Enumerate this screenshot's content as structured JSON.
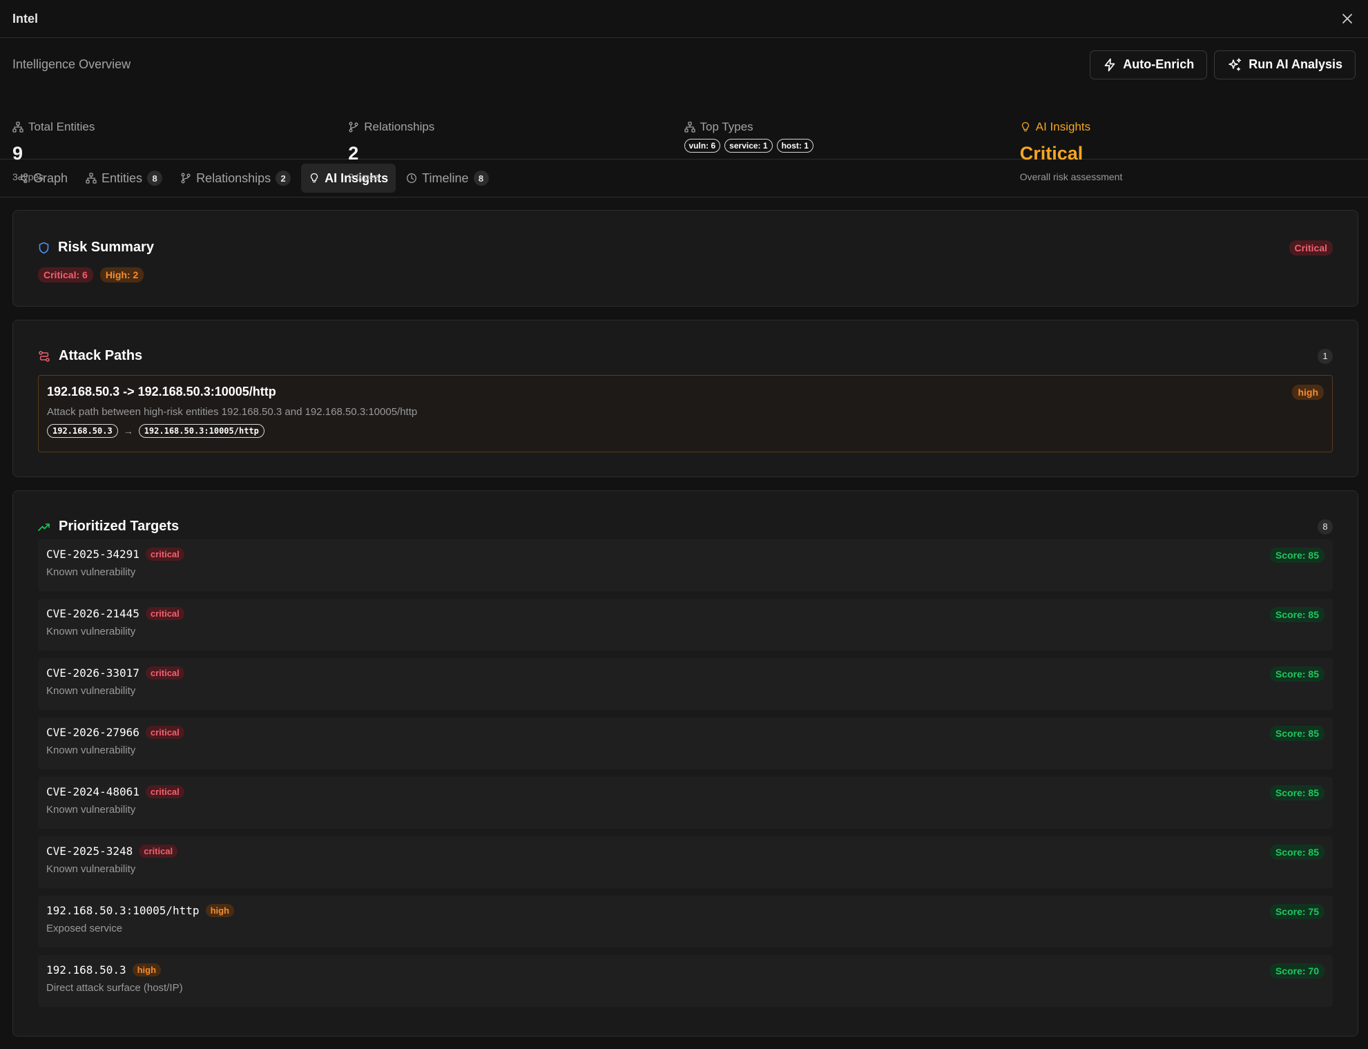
{
  "window": {
    "title": "Intel"
  },
  "overview": {
    "title": "Intelligence Overview",
    "actions": {
      "auto_enrich": "Auto-Enrich",
      "run_ai": "Run AI Analysis"
    },
    "stats": {
      "total": {
        "label": "Total Entities",
        "value": "9",
        "sub": "3 types"
      },
      "relationships": {
        "label": "Relationships",
        "value": "2",
        "sub": "2 types"
      },
      "top_types": {
        "label": "Top Types",
        "chips": [
          "vuln: 6",
          "service: 1",
          "host: 1"
        ]
      },
      "ai": {
        "label": "AI Insights",
        "value": "Critical",
        "sub": "Overall risk assessment"
      }
    }
  },
  "tabs": [
    {
      "label": "Graph",
      "count": ""
    },
    {
      "label": "Entities",
      "count": "8"
    },
    {
      "label": "Relationships",
      "count": "2"
    },
    {
      "label": "AI Insights",
      "count": ""
    },
    {
      "label": "Timeline",
      "count": "8"
    }
  ],
  "risk_summary": {
    "title": "Risk Summary",
    "level": "Critical",
    "critical": "Critical: 6",
    "high": "High: 2"
  },
  "attack_paths": {
    "title": "Attack Paths",
    "count": "1",
    "items": [
      {
        "title": "192.168.50.3 -> 192.168.50.3:10005/http",
        "severity": "high",
        "description": "Attack path between high-risk entities 192.168.50.3 and 192.168.50.3:10005/http",
        "from": "192.168.50.3",
        "arrow": "→",
        "to": "192.168.50.3:10005/http"
      }
    ]
  },
  "targets": {
    "title": "Prioritized Targets",
    "count": "8",
    "items": [
      {
        "name": "CVE-2025-34291",
        "severity": "critical",
        "desc": "Known vulnerability",
        "score": "Score: 85"
      },
      {
        "name": "CVE-2026-21445",
        "severity": "critical",
        "desc": "Known vulnerability",
        "score": "Score: 85"
      },
      {
        "name": "CVE-2026-33017",
        "severity": "critical",
        "desc": "Known vulnerability",
        "score": "Score: 85"
      },
      {
        "name": "CVE-2026-27966",
        "severity": "critical",
        "desc": "Known vulnerability",
        "score": "Score: 85"
      },
      {
        "name": "CVE-2024-48061",
        "severity": "critical",
        "desc": "Known vulnerability",
        "score": "Score: 85"
      },
      {
        "name": "CVE-2025-3248",
        "severity": "critical",
        "desc": "Known vulnerability",
        "score": "Score: 85"
      },
      {
        "name": "192.168.50.3:10005/http",
        "severity": "high",
        "desc": "Exposed service",
        "score": "Score: 75"
      },
      {
        "name": "192.168.50.3",
        "severity": "high",
        "desc": "Direct attack surface (host/IP)",
        "score": "Score: 70"
      }
    ]
  },
  "colors": {
    "background": "#121212",
    "card": "#1a1a1a",
    "accent_amber": "#f5a623",
    "critical": "#f0616d",
    "high": "#f48c2f",
    "score": "#22c55e",
    "shield": "#4f8ef7"
  },
  "icons": {
    "close": "close-icon",
    "auto_enrich": "lightning-icon",
    "run_ai": "sparkles-icon",
    "entities": "network-icon",
    "relationships": "git-branch-icon",
    "ai_insights": "lightbulb-icon",
    "graph": "share-nodes-icon",
    "timeline": "clock-icon",
    "risk_summary": "shield-icon",
    "attack_paths": "route-icon",
    "targets": "trending-up-icon"
  }
}
